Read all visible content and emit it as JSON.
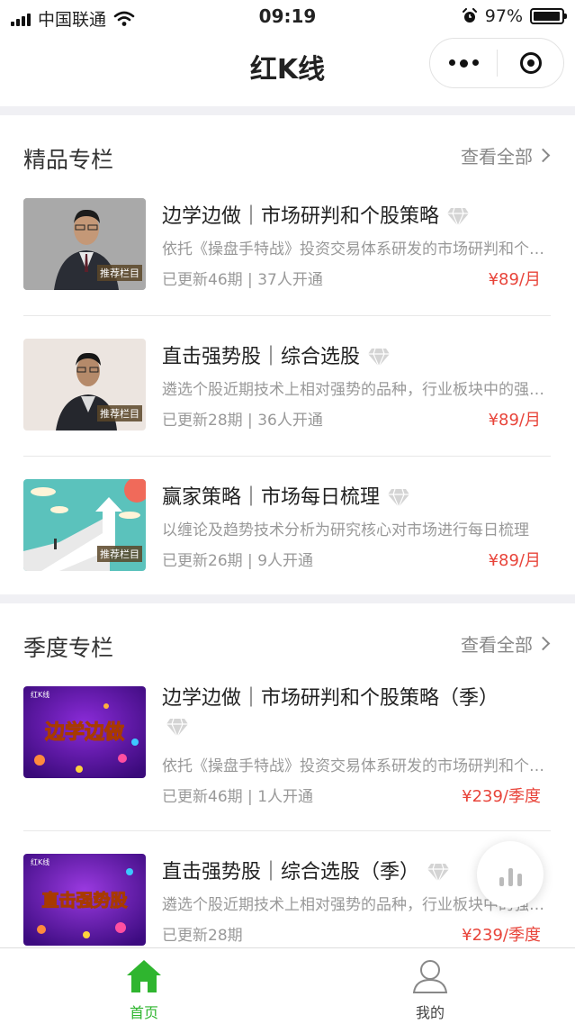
{
  "status_bar": {
    "carrier": "中国联通",
    "time": "09:19",
    "battery": "97%",
    "battery_level": 0.97
  },
  "nav": {
    "title": "红K线"
  },
  "sections": [
    {
      "title": "精品专栏",
      "view_all": "查看全部",
      "items": [
        {
          "title": "边学边做｜市场研判和个股策略",
          "desc": "依托《操盘手特战》投资交易体系研发的市场研判和个股策略",
          "updates": "已更新46期",
          "subscribers": "37人开通",
          "price": "¥89/月",
          "badge": "推荐栏目",
          "thumb": "portrait-1"
        },
        {
          "title": "直击强势股｜综合选股",
          "desc": "遴选个股近期技术上相对强势的品种，行业板块中的强势个股",
          "updates": "已更新28期",
          "subscribers": "36人开通",
          "price": "¥89/月",
          "badge": "推荐栏目",
          "thumb": "portrait-2"
        },
        {
          "title": "赢家策略｜市场每日梳理",
          "desc": "以缠论及趋势技术分析为研究核心对市场进行每日梳理",
          "updates": "已更新26期",
          "subscribers": "9人开通",
          "price": "¥89/月",
          "badge": "推荐栏目",
          "thumb": "arrow-illustration"
        }
      ]
    },
    {
      "title": "季度专栏",
      "view_all": "查看全部",
      "items": [
        {
          "title": "边学边做｜市场研判和个股策略（季）",
          "desc": "依托《操盘手特战》投资交易体系研发的市场研判和个股策略",
          "updates": "已更新46期",
          "subscribers": "1人开通",
          "price": "¥239/季度",
          "thumb_text": "边学边做",
          "brand": "红K线"
        },
        {
          "title": "直击强势股｜综合选股（季）",
          "desc": "遴选个股近期技术上相对强势的品种，行业板块中的强势个股",
          "updates": "已更新28期",
          "subscribers": "",
          "price": "¥239/季度",
          "thumb_text": "直击强势股",
          "brand": "红K线"
        }
      ]
    }
  ],
  "tabs": [
    {
      "label": "首页",
      "icon": "home-icon",
      "active": true
    },
    {
      "label": "我的",
      "icon": "profile-icon",
      "active": false
    }
  ],
  "colors": {
    "price": "#e8443a",
    "active_tab": "#2fb52f",
    "inactive_tab": "#444444"
  }
}
